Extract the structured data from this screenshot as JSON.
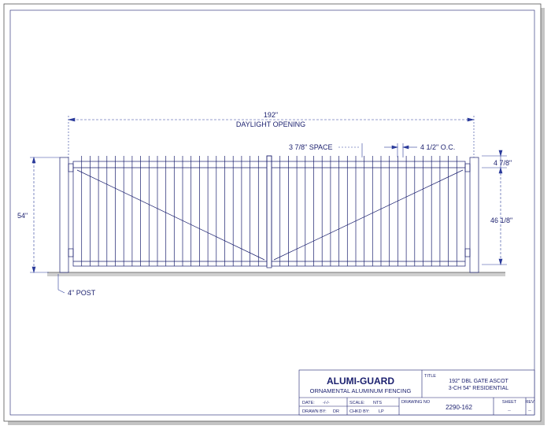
{
  "drawing": {
    "dimensions": {
      "daylight_opening": "192\"",
      "daylight_opening_label": "DAYLIGHT OPENING",
      "picket_space": "3 7/8\" SPACE",
      "picket_oc": "4 1/2\" O.C.",
      "top_offset": "4 7/8\"",
      "gate_height": "54\"",
      "inner_height": "46 1/8\"",
      "post_callout": "4\" POST"
    }
  },
  "title_block": {
    "company": "ALUMI-GUARD",
    "tagline": "ORNAMENTAL ALUMINUM FENCING",
    "title_label": "TITLE",
    "title_line1": "192\" DBL GATE ASCOT",
    "title_line2": "3-CH 54\" RESIDENTIAL",
    "date_label": "DATE:",
    "date_value": "-/-/-",
    "scale_label": "SCALE:",
    "scale_value": "NTS",
    "drawn_by_label": "DRAWN BY:",
    "drawn_by_value": "DR",
    "chkd_by_label": "CHKD BY:",
    "chkd_by_value": "LP",
    "drawing_no_label": "DRAWING NO",
    "drawing_no_value": "2290-162",
    "sheet_label": "SHEET",
    "sheet_value": "--",
    "rev_label": "REV",
    "rev_value": "--"
  },
  "colors": {
    "line": "#1a1f6e",
    "dim_line": "#2a3a9a",
    "shadow": "#b8b8b8",
    "ground": "#9a9a9a"
  }
}
